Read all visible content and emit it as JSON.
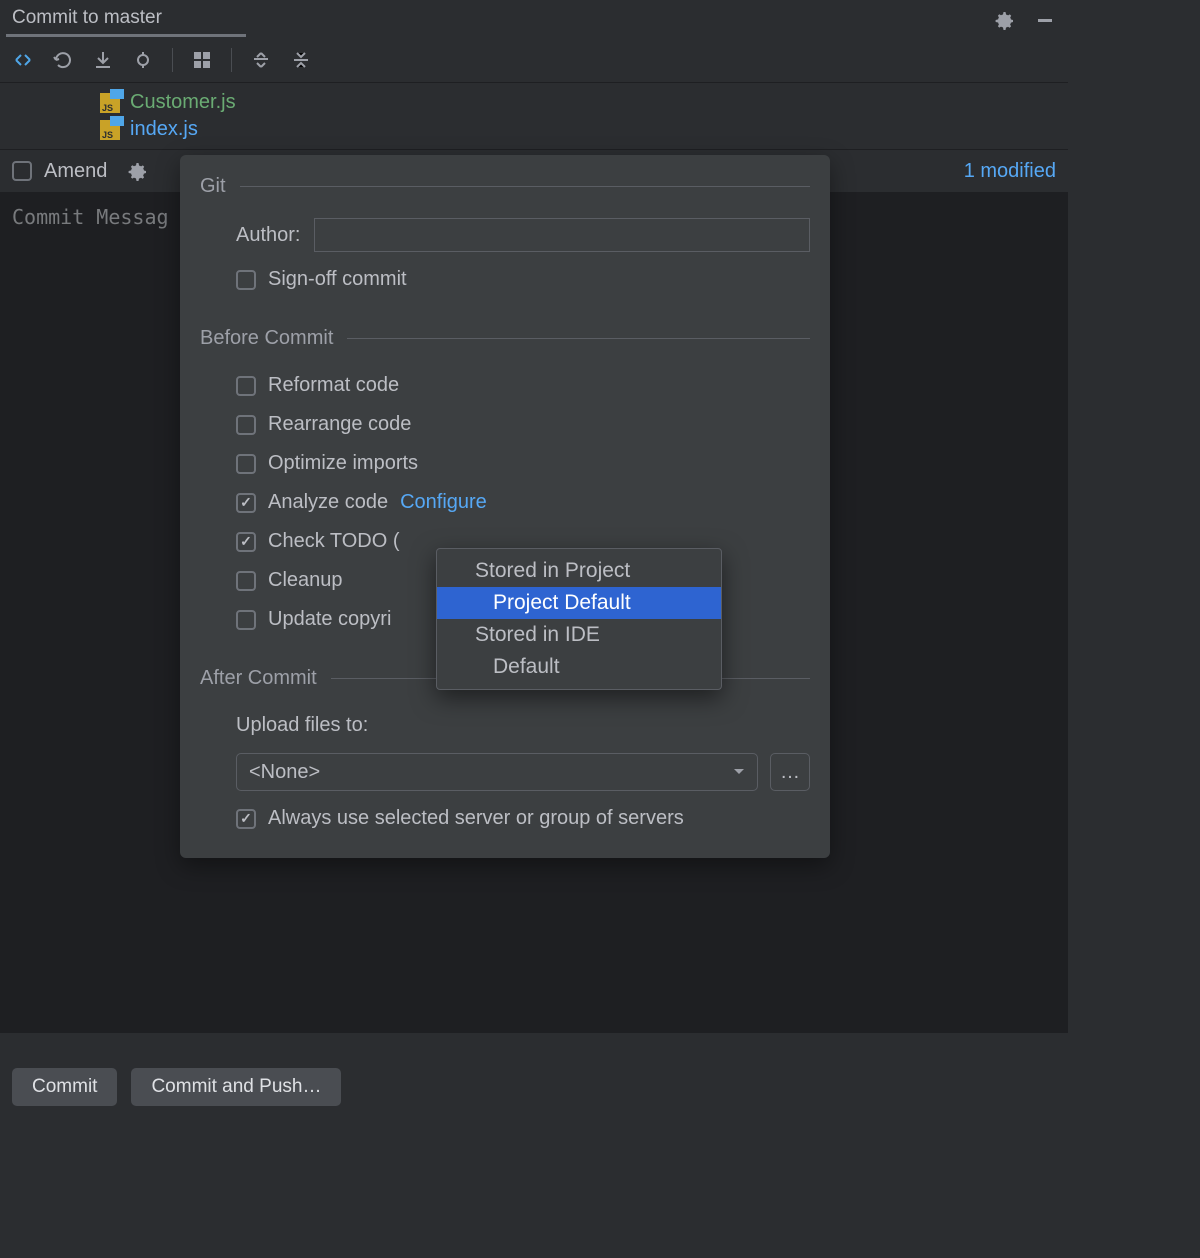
{
  "header": {
    "title": "Commit to master"
  },
  "files": [
    {
      "name": "Customer.js",
      "color": "green"
    },
    {
      "name": "index.js",
      "color": "blue"
    }
  ],
  "amend": {
    "label": "Amend",
    "modified": "1 modified"
  },
  "commit_message_placeholder": "Commit Messag",
  "popover": {
    "sections": {
      "git": "Git",
      "before": "Before Commit",
      "after": "After Commit"
    },
    "git": {
      "author_label": "Author:",
      "author_value": "",
      "signoff_label": "Sign-off commit",
      "signoff_checked": false
    },
    "before": [
      {
        "label": "Reformat code",
        "checked": false
      },
      {
        "label": "Rearrange code",
        "checked": false
      },
      {
        "label": "Optimize imports",
        "checked": false
      },
      {
        "label": "Analyze code",
        "checked": true,
        "link": "Configure"
      },
      {
        "label": "Check TODO (",
        "checked": true
      },
      {
        "label": "Cleanup",
        "checked": false
      },
      {
        "label": "Update copyri",
        "checked": false
      }
    ],
    "after": {
      "upload_label": "Upload files to:",
      "upload_value": "<None>",
      "always_use_label": "Always use selected server or group of servers",
      "always_use_checked": true
    }
  },
  "dropdown": {
    "items": [
      {
        "label": "Stored in Project",
        "indent": false,
        "selected": false
      },
      {
        "label": "Project Default",
        "indent": true,
        "selected": true
      },
      {
        "label": "Stored in IDE",
        "indent": false,
        "selected": false
      },
      {
        "label": "Default",
        "indent": true,
        "selected": false
      }
    ]
  },
  "footer": {
    "commit": "Commit",
    "commit_push": "Commit and Push…"
  }
}
